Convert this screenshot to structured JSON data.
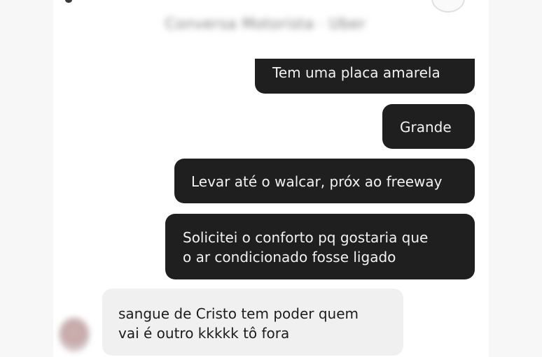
{
  "chat": {
    "header_name_blurred": "Conversa Motorista · Uber",
    "messages": [
      {
        "from": "me",
        "lines": [
          "Tem uma placa amarela"
        ]
      },
      {
        "from": "me",
        "lines": [
          "Grande"
        ]
      },
      {
        "from": "me",
        "lines": [
          "Levar até o walcar, próx ao freeway"
        ]
      },
      {
        "from": "me",
        "lines": [
          "Solicitei o conforto pq gostaria que",
          "o ar condicionado fosse ligado"
        ]
      },
      {
        "from": "them",
        "lines": [
          "sangue de Cristo tem poder quem",
          "vai é outro kkkkk tô fora"
        ]
      }
    ]
  },
  "colors": {
    "outgoing_bubble": "#1f1f1f",
    "outgoing_text": "#f2f2f2",
    "incoming_bubble": "#f0f0f0",
    "incoming_text": "#1c1c1c"
  }
}
